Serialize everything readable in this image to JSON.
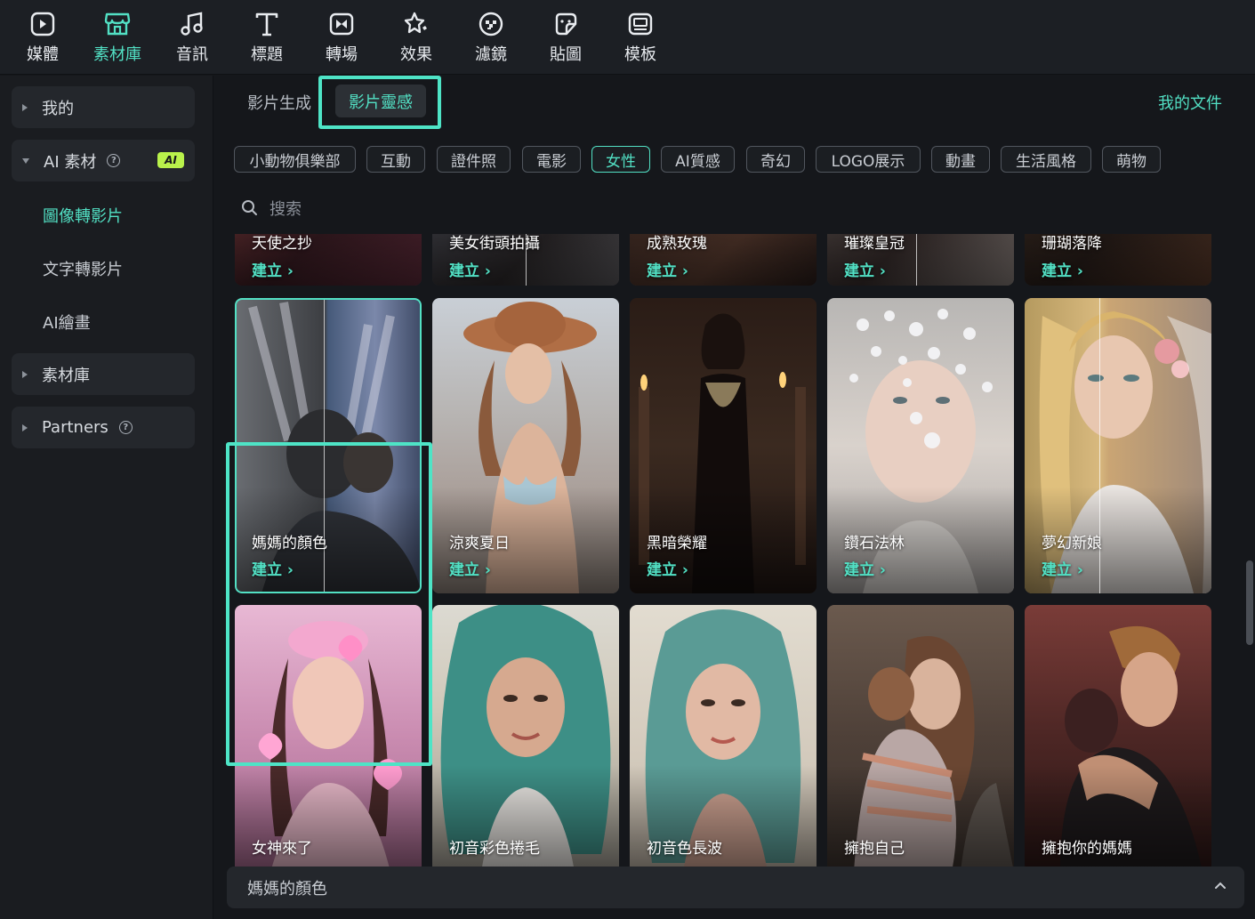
{
  "toolbar": {
    "items": [
      {
        "label": "媒體",
        "icon": "media-icon"
      },
      {
        "label": "素材庫",
        "icon": "stock-library-icon"
      },
      {
        "label": "音訊",
        "icon": "music-note-icon"
      },
      {
        "label": "標題",
        "icon": "text-t-icon"
      },
      {
        "label": "轉場",
        "icon": "transition-icon"
      },
      {
        "label": "效果",
        "icon": "effects-star-icon"
      },
      {
        "label": "濾鏡",
        "icon": "filter-icon"
      },
      {
        "label": "貼圖",
        "icon": "sticker-icon"
      },
      {
        "label": "模板",
        "icon": "template-icon"
      }
    ],
    "active": "素材庫"
  },
  "sidebar": {
    "my": "我的",
    "ai_stock": "AI 素材",
    "ai_badge": "AI",
    "sub_items": [
      "圖像轉影片",
      "文字轉影片",
      "AI繪畫"
    ],
    "library": "素材庫",
    "partners": "Partners"
  },
  "tabs": {
    "video_gen": "影片生成",
    "inspiration": "影片靈感",
    "my_docs": "我的文件"
  },
  "chips": [
    "小動物俱樂部",
    "互動",
    "證件照",
    "電影",
    "女性",
    "AI質感",
    "奇幻",
    "LOGO展示",
    "動畫",
    "生活風格",
    "萌物"
  ],
  "active_chip": "女性",
  "search": {
    "placeholder": "搜索"
  },
  "create_label": "建立",
  "cards_row0": [
    "天使之抄",
    "美女街頭拍攝",
    "成熟玫瑰",
    "璀璨皇冠",
    "珊瑚落降"
  ],
  "cards_row1": [
    "媽媽的顏色",
    "涼爽夏日",
    "黑暗榮耀",
    "鑽石法林",
    "夢幻新娘"
  ],
  "cards_row2": [
    "女神來了",
    "初音彩色捲毛",
    "初音色長波",
    "擁抱自己",
    "擁抱你的媽媽"
  ],
  "bottom": {
    "label": "媽媽的顏色"
  }
}
